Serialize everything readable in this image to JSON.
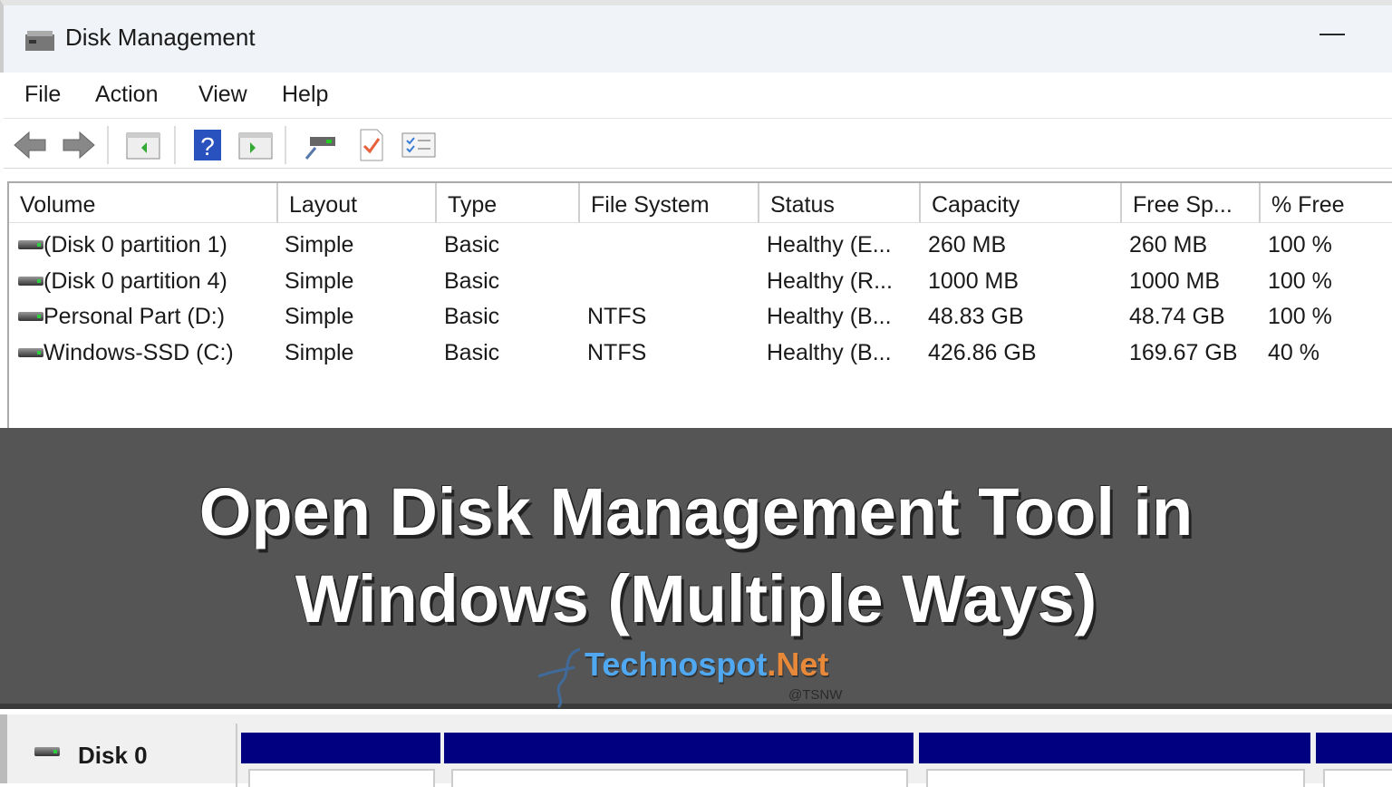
{
  "window": {
    "title": "Disk Management",
    "minimize_label": "—"
  },
  "menu": [
    "File",
    "Action",
    "View",
    "Help"
  ],
  "toolbar": [
    "back-icon",
    "forward-icon",
    "show-hide-console-tree-icon",
    "help-icon",
    "show-hide-action-pane-icon",
    "rescan-disks-icon",
    "properties-check-icon",
    "checklist-icon"
  ],
  "columns": [
    "Volume",
    "Layout",
    "Type",
    "File System",
    "Status",
    "Capacity",
    "Free Sp...",
    "% Free"
  ],
  "rows": [
    [
      "(Disk 0 partition 1)",
      "Simple",
      "Basic",
      "",
      "Healthy (E...",
      "260 MB",
      "260 MB",
      "100 %"
    ],
    [
      "(Disk 0 partition 4)",
      "Simple",
      "Basic",
      "",
      "Healthy (R...",
      "1000 MB",
      "1000 MB",
      "100 %"
    ],
    [
      "Personal Part (D:)",
      "Simple",
      "Basic",
      "NTFS",
      "Healthy (B...",
      "48.83 GB",
      "48.74 GB",
      "100 %"
    ],
    [
      "Windows-SSD (C:)",
      "Simple",
      "Basic",
      "NTFS",
      "Healthy (B...",
      "426.86 GB",
      "169.67 GB",
      "40 %"
    ]
  ],
  "banner": {
    "line1": "Open Disk Management Tool in",
    "line2": "Windows (Multiple Ways)",
    "logo_main": "Technospot",
    "logo_net": ".Net",
    "logo_handle": "@TSNW"
  },
  "disk_panel": {
    "disk_label": "Disk 0"
  },
  "colors": {
    "partition_bar": "#000080",
    "logo_blue": "#4fa8f0",
    "logo_orange": "#e8893a"
  }
}
